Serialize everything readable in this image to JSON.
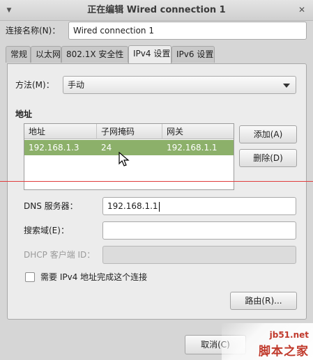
{
  "window": {
    "title": "正在编辑 Wired connection 1",
    "menu_glyph": "▼",
    "close_glyph": "✕"
  },
  "connection_name": {
    "label": "连接名称(N)：",
    "value": "Wired connection 1"
  },
  "tabs": [
    {
      "label": "常规"
    },
    {
      "label": "以太网"
    },
    {
      "label": "802.1X 安全性"
    },
    {
      "label": "IPv4 设置"
    },
    {
      "label": "IPv6 设置"
    }
  ],
  "active_tab": "IPv4 设置",
  "ipv4": {
    "method_label": "方法(M)：",
    "method_value": "手动",
    "address_section_title": "地址",
    "columns": [
      "地址",
      "子网掩码",
      "网关"
    ],
    "rows": [
      {
        "address": "192.168.1.3",
        "netmask": "24",
        "gateway": "192.168.1.1"
      }
    ],
    "add_button": "添加(A)",
    "delete_button": "删除(D)",
    "dns_label": "DNS 服务器：",
    "dns_value": "192.168.1.1",
    "search_label": "搜索域(E)：",
    "search_value": "",
    "dhcp_label": "DHCP 客户端 ID：",
    "dhcp_value": "",
    "require_ipv4_label": "需要 IPv4 地址完成这个连接",
    "require_ipv4_checked": false,
    "routes_button": "路由(R)..."
  },
  "footer": {
    "cancel_button": "取消(C)"
  },
  "watermark": {
    "site": "jb51.net",
    "name": "脚本之家"
  },
  "colors": {
    "selected_row": "#8cb06a",
    "red_guide_line": "#e03c3c"
  }
}
